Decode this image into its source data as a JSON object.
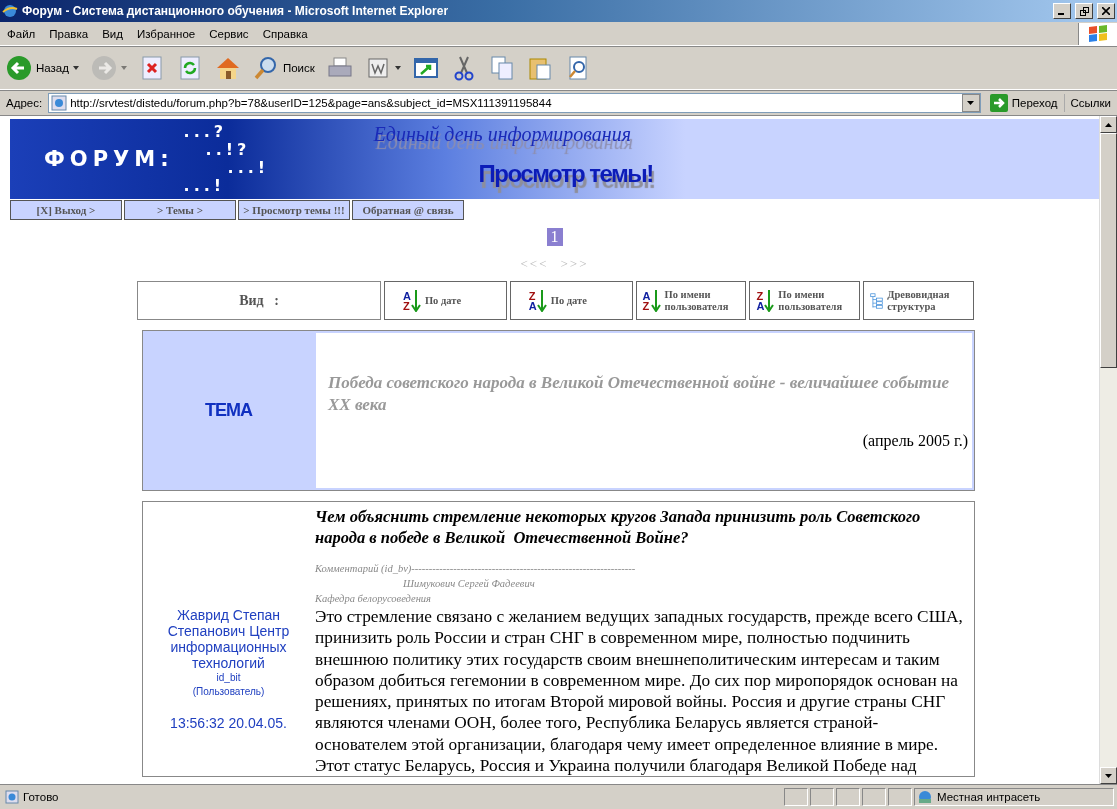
{
  "window": {
    "title": "Форум - Система дистанционного обучения - Microsoft Internet Explorer"
  },
  "menu": [
    "Файл",
    "Правка",
    "Вид",
    "Избранное",
    "Сервис",
    "Справка"
  ],
  "toolbar": [
    {
      "kind": "back",
      "label": "Назад",
      "dropdown": true,
      "disabled": false
    },
    {
      "kind": "forward",
      "dropdown": true,
      "disabled": true
    },
    {
      "kind": "stop",
      "disabled": false
    },
    {
      "kind": "refresh",
      "disabled": false
    },
    {
      "kind": "home",
      "disabled": false
    },
    {
      "kind": "search",
      "label": "Поиск",
      "disabled": false
    },
    {
      "kind": "print",
      "disabled": false
    },
    {
      "kind": "edit",
      "dropdown": true,
      "disabled": false
    },
    {
      "kind": "window",
      "disabled": false
    },
    {
      "kind": "cut",
      "disabled": false
    },
    {
      "kind": "copy",
      "disabled": false
    },
    {
      "kind": "paste",
      "disabled": false
    },
    {
      "kind": "preview",
      "disabled": false
    }
  ],
  "address": {
    "label": "Адрес:",
    "value": "http://srvtest/distedu/forum.php?b=78&userID=125&page=ans&subject_id=MSX111391195844",
    "go": "Переход",
    "links": "Ссылки"
  },
  "banner": {
    "logo": "ФОРУМ:",
    "marks": [
      "...?",
      "..!?",
      "...!",
      "...!"
    ],
    "slogan": "Единый день информирования",
    "heading": "Просмотр темы!"
  },
  "nav": [
    "[X] Выход >",
    "> Темы >",
    "> Просмотр темы !!!",
    "Обратная @ связь"
  ],
  "pager": {
    "pages": [
      {
        "label": "1",
        "selected": true
      }
    ],
    "prev": "<<<",
    "next": ">>>"
  },
  "view": {
    "label": "Вид   :",
    "sorts": [
      {
        "kind": "order",
        "top": "A",
        "bottom": "Z",
        "label": "По дате"
      },
      {
        "kind": "order",
        "top": "Z",
        "bottom": "A",
        "label": "По дате"
      },
      {
        "kind": "order",
        "top": "A",
        "bottom": "Z",
        "label": "По имени пользователя"
      },
      {
        "kind": "order",
        "top": "Z",
        "bottom": "A",
        "label": "По имени пользователя"
      },
      {
        "kind": "tree",
        "label": "Древовидная структура"
      }
    ]
  },
  "topic": {
    "label": "ТЕМА",
    "title": "Победа советского народа в Великой Отечественной войне - величайшее событие XX века",
    "date": "(апрель 2005 г.)"
  },
  "post": {
    "author": "Жаврид Степан Степанович Центр информационных технологий",
    "login": "id_bit",
    "role": "(Пользователь)",
    "time": "13:56:32 20.04.05.",
    "question": "Чем объяснить стремление некоторых кругов Запада принизить роль Советского народа в победе в Великой  Отечественной Войне?",
    "comment_header": "Комментарий (id_bv)----------------------------------------------------------------",
    "commenter": "Шимукович Сергей Фадеевич",
    "department": "Кафедра белорусоведения",
    "body": "Это стремление связано с желанием ведущих западных государств, прежде всего США, принизить роль России и стран СНГ в современном мире, полностью подчинить внешнюю политику этих государств своим внешнеполитическим интересам и таким образом добиться гегемонии в современном мире. До сих пор миропорядок основан на решениях, принятых по итогам Второй мировой войны. Россия и другие страны СНГ являются членами ООН, более того, Республика Беларусь является страной-основателем этой организации, благодаря чему имеет определенное влияние в мире. Этот статус Беларусь, Россия и Украина получили благодаря Великой Победе над"
  },
  "status": {
    "text": "Готово",
    "zone": "Местная интрасеть"
  }
}
